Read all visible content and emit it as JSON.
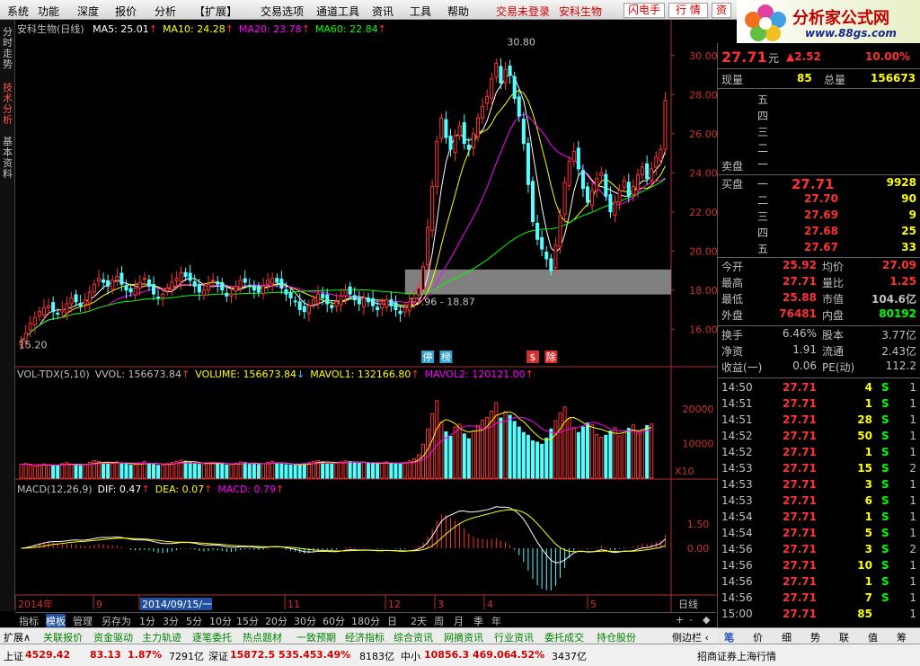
{
  "menu": {
    "items": [
      "系统",
      "功能",
      "深度",
      "报价",
      "分析",
      "【扩展】",
      "交易选项",
      "通道工具",
      "资讯",
      "工具",
      "帮助"
    ],
    "login_status": "交易未登录",
    "stock_name": "安科生物",
    "flash_btn": "闪电手",
    "quote_btn": "行 情",
    "info_btn": "资"
  },
  "logo": {
    "title": "分析家公式网",
    "url": "www.88gs.com"
  },
  "left_tabs": [
    "分时走势",
    "技术分析",
    "基本资料"
  ],
  "chart": {
    "title": "安科生物(日线)",
    "ma": [
      {
        "label": "MA5: 25.01",
        "color": "#ffffff"
      },
      {
        "label": "MA10: 24.28",
        "color": "#ffff00"
      },
      {
        "label": "MA20: 23.78",
        "color": "#ff00ff"
      },
      {
        "label": "MA60: 22.84",
        "color": "#00ff00"
      }
    ],
    "price_labels": [
      "30.00",
      "28.00",
      "26.00",
      "24.00",
      "22.00",
      "20.00",
      "18.00",
      "16.00"
    ],
    "high_mark": "30.80",
    "low_mark": "15.20",
    "box_label": "17.96 - 18.87",
    "event_tags": [
      "停",
      "榜",
      "$",
      "除"
    ],
    "vol_title": "VOL-TDX(5,10)",
    "vol_items": [
      {
        "label": "VVOL: 156673.84",
        "color": "#c0c0c0"
      },
      {
        "label": "VOLUME: 156673.84",
        "color": "#ffff00"
      },
      {
        "label": "MAVOL1: 132166.80",
        "color": "#ffff00"
      },
      {
        "label": "MAVOL2: 120121.00",
        "color": "#ff00ff"
      }
    ],
    "vol_labels": [
      "20000",
      "10000"
    ],
    "vol_unit": "X10",
    "macd_title": "MACD(12,26,9)",
    "macd_items": [
      {
        "label": "DIF: 0.47",
        "color": "#ffffff"
      },
      {
        "label": "DEA: 0.07",
        "color": "#ffff00"
      },
      {
        "label": "MACD: 0.79",
        "color": "#ff00ff"
      }
    ],
    "macd_labels": [
      "1.50",
      "0.00"
    ],
    "date_axis": [
      {
        "label": "2014年",
        "highlight": false
      },
      {
        "label": "9",
        "highlight": false
      },
      {
        "label": "2014/09/15/一",
        "highlight": true
      },
      {
        "label": "11",
        "highlight": false
      },
      {
        "label": "12",
        "highlight": false
      },
      {
        "label": "3",
        "highlight": false
      },
      {
        "label": "4",
        "highlight": false
      },
      {
        "label": "5",
        "highlight": false
      }
    ],
    "period": "日线"
  },
  "bottom_toolbar": [
    "指标",
    "模板",
    "管理",
    "另存为",
    "1分",
    "3分",
    "5分",
    "10分",
    "15分",
    "20分",
    "30分",
    "60分",
    "180分",
    "日",
    "2天",
    "周",
    "月",
    "季",
    "年"
  ],
  "bottom_right": [
    "+",
    "-",
    "◆"
  ],
  "func_bar": [
    "扩展∧",
    "关联报价",
    "资金驱动",
    "主力轨迹",
    "逐笔委托",
    "热点题材",
    "一致预期",
    "经济指标",
    "综合资讯",
    "网摘资讯",
    "行业资讯",
    "委托成交",
    "持仓股份"
  ],
  "func_bar_side": "侧边栏 ‹",
  "status_bar": {
    "sh_label": "上证",
    "sh_value": "4529.42",
    "sh_change": "83.13",
    "sh_pct": "1.87%",
    "sh_amount": "7291亿",
    "sz_label": "深证",
    "sz_value": "15872.5",
    "sz_change": "535.45",
    "sz_pct": "3.49%",
    "sz_amount": "8183亿",
    "zx_label": "中小",
    "zx_value": "10856.3",
    "zx_change": "469.06",
    "zx_pct": "4.52%",
    "zx_amount": "3437亿",
    "broker": "招商证券上海行情"
  },
  "quote": {
    "price": "27.71",
    "price_unit": "元",
    "change": "▲2.52",
    "pct": "10.00%",
    "cur_vol_label": "现量",
    "cur_vol": "85",
    "total_vol_label": "总量",
    "total_vol": "156673",
    "sell_label": "卖盘",
    "sell_rows": [
      "五",
      "四",
      "三",
      "二",
      "一"
    ],
    "buy_label": "买盘",
    "buy_rows": [
      {
        "level": "一",
        "price": "27.71",
        "vol": "9928"
      },
      {
        "level": "二",
        "price": "27.70",
        "vol": "90"
      },
      {
        "level": "三",
        "price": "27.69",
        "vol": "9"
      },
      {
        "level": "四",
        "price": "27.68",
        "vol": "25"
      },
      {
        "level": "五",
        "price": "27.67",
        "vol": "33"
      }
    ],
    "stats": [
      {
        "l1": "今开",
        "v1": "25.92",
        "l2": "均价",
        "v2": "27.09"
      },
      {
        "l1": "最高",
        "v1": "27.71",
        "l2": "量比",
        "v2": "1.25"
      },
      {
        "l1": "最低",
        "v1": "25.88",
        "l2": "市值",
        "v2": "104.6亿"
      },
      {
        "l1": "外盘",
        "v1": "76481",
        "l2": "内盘",
        "v2": "80192"
      }
    ],
    "stats2": [
      {
        "l1": "换手",
        "v1": "6.46%",
        "l2": "股本",
        "v2": "3.77亿"
      },
      {
        "l1": "净资",
        "v1": "1.91",
        "l2": "流通",
        "v2": "2.43亿"
      },
      {
        "l1": "收益(一)",
        "v1": "0.06",
        "l2": "PE(动)",
        "v2": "112.2"
      }
    ],
    "ticks": [
      {
        "t": "14:50",
        "p": "27.71",
        "v": "4",
        "s": "S",
        "n": "1"
      },
      {
        "t": "14:51",
        "p": "27.71",
        "v": "1",
        "s": "S",
        "n": "1"
      },
      {
        "t": "14:51",
        "p": "27.71",
        "v": "28",
        "s": "S",
        "n": "1"
      },
      {
        "t": "14:52",
        "p": "27.71",
        "v": "50",
        "s": "S",
        "n": "1"
      },
      {
        "t": "14:52",
        "p": "27.71",
        "v": "1",
        "s": "S",
        "n": "1"
      },
      {
        "t": "14:53",
        "p": "27.71",
        "v": "15",
        "s": "S",
        "n": "2"
      },
      {
        "t": "14:53",
        "p": "27.71",
        "v": "3",
        "s": "S",
        "n": "1"
      },
      {
        "t": "14:53",
        "p": "27.71",
        "v": "6",
        "s": "S",
        "n": "1"
      },
      {
        "t": "14:54",
        "p": "27.71",
        "v": "1",
        "s": "S",
        "n": "1"
      },
      {
        "t": "14:54",
        "p": "27.71",
        "v": "5",
        "s": "S",
        "n": "1"
      },
      {
        "t": "14:56",
        "p": "27.71",
        "v": "3",
        "s": "S",
        "n": "2"
      },
      {
        "t": "14:56",
        "p": "27.71",
        "v": "10",
        "s": "S",
        "n": "1"
      },
      {
        "t": "14:56",
        "p": "27.71",
        "v": "1",
        "s": "S",
        "n": "1"
      },
      {
        "t": "14:56",
        "p": "27.71",
        "v": "7",
        "s": "S",
        "n": "1"
      },
      {
        "t": "15:00",
        "p": "27.71",
        "v": "85",
        "s": "",
        "n": "1"
      }
    ]
  },
  "right_tabs": [
    "笔",
    "价",
    "细",
    "势",
    "联",
    "值",
    "筹"
  ],
  "chart_data": {
    "type": "candlestick",
    "price_range": [
      15.2,
      30.8
    ],
    "closes": [
      15.4,
      15.8,
      16.3,
      16.6,
      16.9,
      17.1,
      17.2,
      16.9,
      16.8,
      17.0,
      17.3,
      17.6,
      17.4,
      17.2,
      17.5,
      17.9,
      18.3,
      18.6,
      18.4,
      18.2,
      18.5,
      18.7,
      18.3,
      18.0,
      17.9,
      18.1,
      18.4,
      18.6,
      18.2,
      17.8,
      17.6,
      17.8,
      18.1,
      18.4,
      18.6,
      18.9,
      18.7,
      18.5,
      18.2,
      17.9,
      18.0,
      18.3,
      18.5,
      18.3,
      18.0,
      17.7,
      17.8,
      18.2,
      18.5,
      18.4,
      18.2,
      18.0,
      17.9,
      18.2,
      18.5,
      18.6,
      18.4,
      18.1,
      17.8,
      17.6,
      17.4,
      17.0,
      16.9,
      17.2,
      17.5,
      17.8,
      17.6,
      17.3,
      17.1,
      17.4,
      17.7,
      18.0,
      17.8,
      17.5,
      17.3,
      17.6,
      17.4,
      17.2,
      17.0,
      17.3,
      17.5,
      17.2,
      17.0,
      16.8,
      17.1,
      17.4,
      17.6,
      18.1,
      19.2,
      21.2,
      23.3,
      25.6,
      26.8,
      25.8,
      25.2,
      25.9,
      26.4,
      25.5,
      25.2,
      26.0,
      26.8,
      27.4,
      27.9,
      28.8,
      29.6,
      28.6,
      29.3,
      29.0,
      27.8,
      26.9,
      25.5,
      23.4,
      21.5,
      20.6,
      20.1,
      19.6,
      19.0,
      20.3,
      21.8,
      23.5,
      24.6,
      25.1,
      24.2,
      23.2,
      22.5,
      23.1,
      23.7,
      24.0,
      22.8,
      22.0,
      22.5,
      23.1,
      23.6,
      22.8,
      23.3,
      23.9,
      24.3,
      23.7,
      24.2,
      24.8,
      25.2,
      27.7
    ],
    "volumes": [
      4000,
      4200,
      3800,
      3500,
      3600,
      4100,
      3900,
      3700,
      3600,
      4200,
      4500,
      4100,
      3800,
      3600,
      3900,
      4600,
      5100,
      4800,
      4400,
      4100,
      4300,
      4700,
      4400,
      4000,
      3800,
      3900,
      4400,
      4800,
      4300,
      3900,
      3700,
      3800,
      4200,
      4500,
      4800,
      5200,
      4900,
      4500,
      4200,
      4000,
      4100,
      4300,
      4600,
      4300,
      4000,
      3800,
      3900,
      4300,
      4700,
      4500,
      4200,
      4000,
      3900,
      4200,
      4600,
      4800,
      4400,
      4100,
      3900,
      3800,
      3700,
      4000,
      4200,
      4500,
      4800,
      5100,
      4700,
      4300,
      4100,
      4400,
      4700,
      5000,
      4800,
      4500,
      4300,
      4600,
      4400,
      4200,
      4100,
      4400,
      4700,
      4400,
      4200,
      4100,
      4500,
      5000,
      5600,
      6800,
      9800,
      14200,
      18600,
      22400,
      16200,
      13400,
      12100,
      14800,
      15600,
      12800,
      11400,
      13600,
      15200,
      16800,
      17600,
      19400,
      21800,
      17400,
      19200,
      18200,
      16400,
      14800,
      13200,
      12400,
      10800,
      10400,
      9800,
      11600,
      14200,
      16600,
      18800,
      20600,
      17200,
      14600,
      13200,
      14800,
      16000,
      15400,
      12600,
      11800,
      12400,
      13600,
      14600,
      12200,
      13200,
      14400,
      15400,
      13000,
      14000,
      15200,
      15666
    ],
    "macd": {
      "dif_now": 0.47,
      "dea_now": 0.07,
      "macd_now": 0.79
    }
  }
}
